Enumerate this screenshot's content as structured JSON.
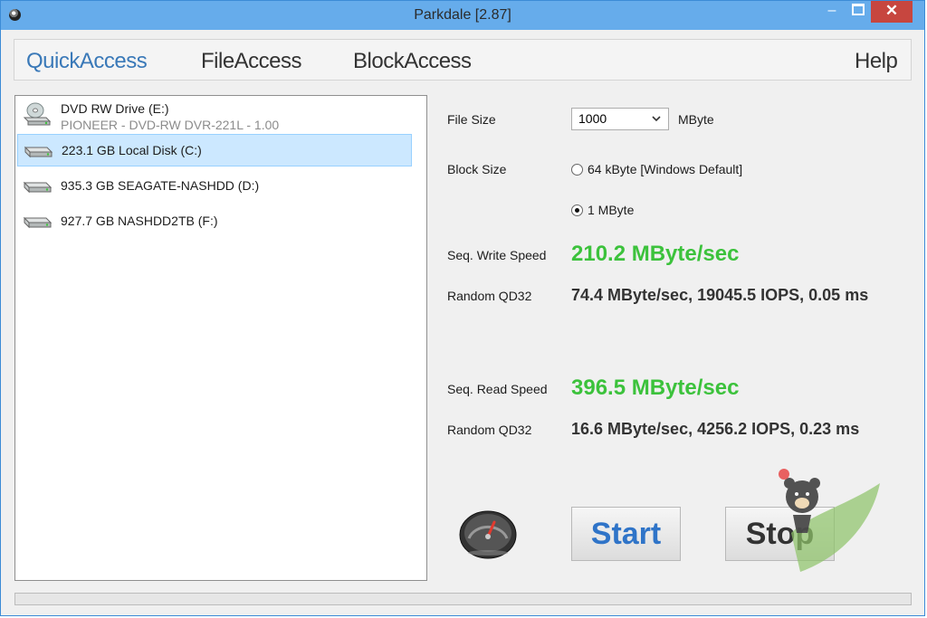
{
  "window": {
    "title": "Parkdale [2.87]",
    "min_glyph": "–",
    "close_glyph": "✕"
  },
  "menu": {
    "items": [
      "QuickAccess",
      "FileAccess",
      "BlockAccess"
    ],
    "help": "Help"
  },
  "drives": [
    {
      "label": "DVD RW Drive (E:)",
      "sub": "PIONEER - DVD-RW  DVR-221L - 1.00",
      "icon": "dvd-drive-icon"
    },
    {
      "label": "223.1 GB Local Disk (C:)",
      "icon": "hard-disk-icon",
      "selected": true
    },
    {
      "label": "935.3 GB SEAGATE-NASHDD (D:)",
      "icon": "hard-disk-icon"
    },
    {
      "label": "927.7 GB NASHDD2TB (F:)",
      "icon": "hard-disk-icon"
    }
  ],
  "settings": {
    "file_size_label": "File Size",
    "file_size_value": "1000",
    "file_size_unit": "MByte",
    "block_size_label": "Block Size",
    "block_options": [
      "64 kByte [Windows Default]",
      "1 MByte"
    ],
    "block_selected": "1 MByte"
  },
  "results": {
    "seq_write_label": "Seq. Write Speed",
    "seq_write_value": "210.2 MByte/sec",
    "rand_write_label": "Random QD32",
    "rand_write_value": "74.4 MByte/sec, 19045.5 IOPS, 0.05 ms",
    "seq_read_label": "Seq. Read Speed",
    "seq_read_value": "396.5 MByte/sec",
    "rand_read_label": "Random QD32",
    "rand_read_value": "16.6 MByte/sec, 4256.2 IOPS, 0.23 ms"
  },
  "buttons": {
    "start": "Start",
    "stop": "Stop"
  },
  "progress": {
    "value": 0
  },
  "colors": {
    "titlebar": "#66aceb",
    "accent_menu": "#3a79b8",
    "speed_green": "#3cc23c",
    "selected_row": "#cce8ff",
    "start_text": "#2f74c8",
    "close_red": "#c7463f"
  },
  "icons": {
    "app": "disk-app-icon",
    "gauge": "speedometer-icon"
  }
}
